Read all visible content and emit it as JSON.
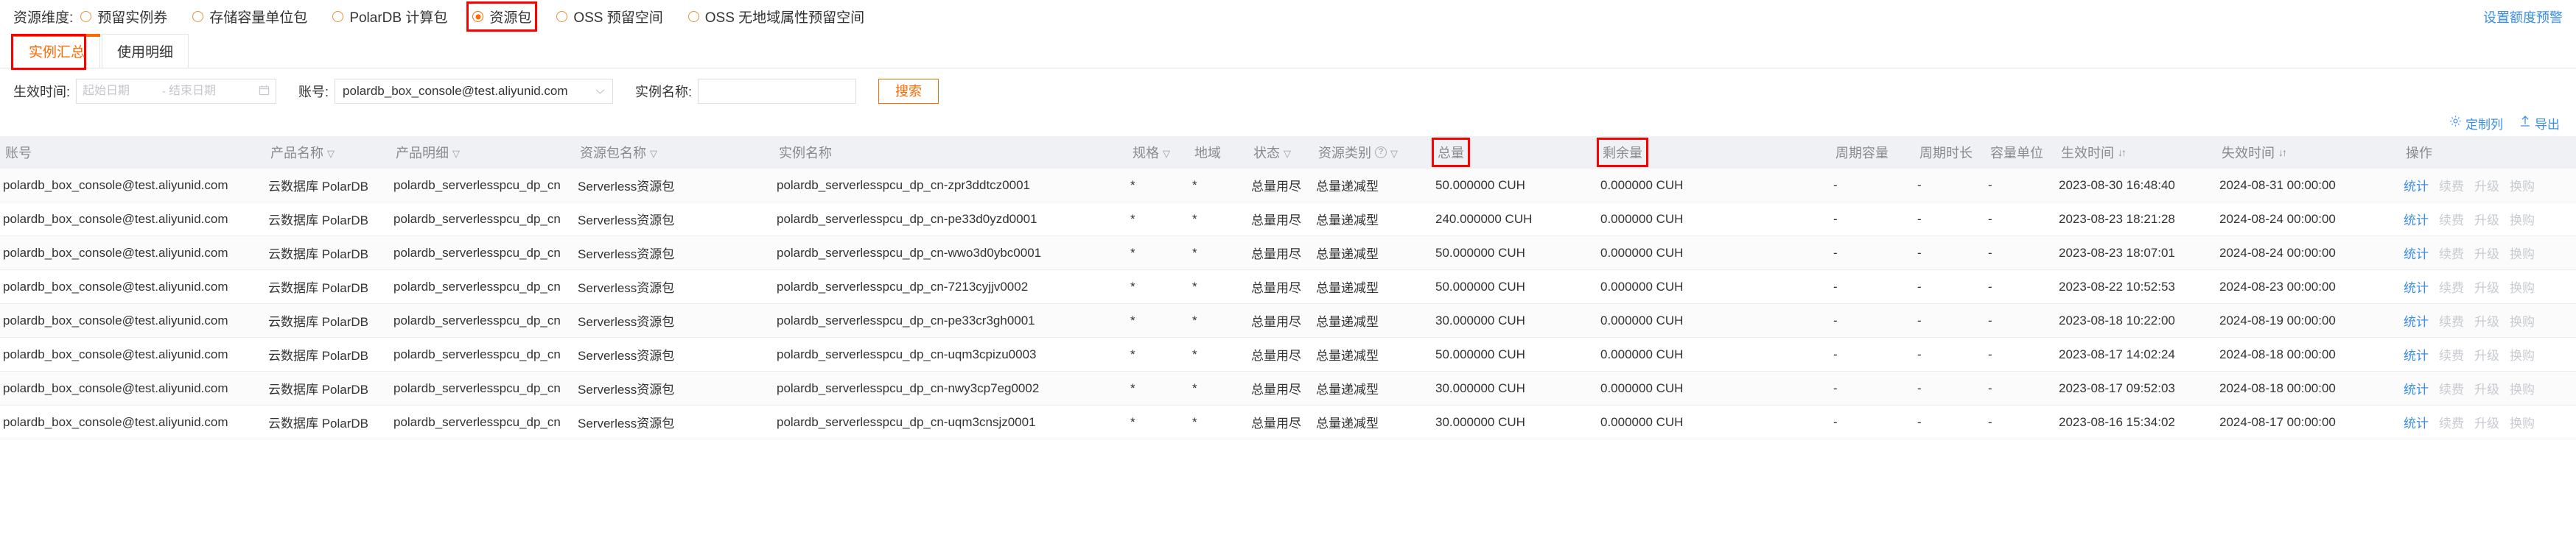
{
  "dimension_bar": {
    "label": "资源维度:",
    "options": [
      {
        "label": "预留实例券",
        "checked": false,
        "highlight": false
      },
      {
        "label": "存储容量单位包",
        "checked": false,
        "highlight": false
      },
      {
        "label": "PolarDB 计算包",
        "checked": false,
        "highlight": false
      },
      {
        "label": "资源包",
        "checked": true,
        "highlight": true
      },
      {
        "label": "OSS 预留空间",
        "checked": false,
        "highlight": false
      },
      {
        "label": "OSS 无地域属性预留空间",
        "checked": false,
        "highlight": false
      }
    ],
    "quota_alert_link": "设置额度预警"
  },
  "tabs": [
    {
      "label": "实例汇总",
      "active": true,
      "highlight": true
    },
    {
      "label": "使用明细",
      "active": false,
      "highlight": false
    }
  ],
  "filters": {
    "effective_time_label": "生效时间:",
    "date_start_placeholder": "起始日期",
    "date_separator": "-",
    "date_end_placeholder": "结束日期",
    "date_start_value": "",
    "date_end_value": "",
    "calendar_icon": "calendar-icon",
    "account_label": "账号:",
    "account_value": "polardb_box_console@test.aliyunid.com",
    "instance_name_label": "实例名称:",
    "instance_name_value": "",
    "instance_name_placeholder": "",
    "search_button": "搜索"
  },
  "toolbar": {
    "customize_columns": "定制列",
    "export": "导出",
    "gear_icon": "gear-icon",
    "export_icon": "upload-icon"
  },
  "table": {
    "columns": [
      {
        "key": "account",
        "label": "账号",
        "filter": false,
        "sort": false,
        "help": false,
        "highlight": false
      },
      {
        "key": "product",
        "label": "产品名称",
        "filter": true,
        "sort": false,
        "help": false,
        "highlight": false
      },
      {
        "key": "product_code",
        "label": "产品明细",
        "filter": true,
        "sort": false,
        "help": false,
        "highlight": false
      },
      {
        "key": "pkg_name",
        "label": "资源包名称",
        "filter": true,
        "sort": false,
        "help": false,
        "highlight": false
      },
      {
        "key": "instance",
        "label": "实例名称",
        "filter": false,
        "sort": false,
        "help": false,
        "highlight": false
      },
      {
        "key": "spec",
        "label": "规格",
        "filter": true,
        "sort": false,
        "help": false,
        "highlight": false
      },
      {
        "key": "region",
        "label": "地域",
        "filter": false,
        "sort": false,
        "help": false,
        "highlight": false
      },
      {
        "key": "status",
        "label": "状态",
        "filter": true,
        "sort": false,
        "help": false,
        "highlight": false
      },
      {
        "key": "res_type",
        "label": "资源类别",
        "filter": true,
        "sort": false,
        "help": true,
        "highlight": false
      },
      {
        "key": "total",
        "label": "总量",
        "filter": false,
        "sort": false,
        "help": false,
        "highlight": true
      },
      {
        "key": "remain",
        "label": "剩余量",
        "filter": false,
        "sort": false,
        "help": false,
        "highlight": true
      },
      {
        "key": "cyc_cap",
        "label": "周期容量",
        "filter": false,
        "sort": false,
        "help": false,
        "highlight": false
      },
      {
        "key": "cyc_len",
        "label": "周期时长",
        "filter": false,
        "sort": false,
        "help": false,
        "highlight": false
      },
      {
        "key": "cap_unit",
        "label": "容量单位",
        "filter": false,
        "sort": false,
        "help": false,
        "highlight": false
      },
      {
        "key": "eff_time",
        "label": "生效时间",
        "filter": false,
        "sort": true,
        "help": false,
        "highlight": false
      },
      {
        "key": "exp_time",
        "label": "失效时间",
        "filter": false,
        "sort": true,
        "help": false,
        "highlight": false
      },
      {
        "key": "actions",
        "label": "操作",
        "filter": false,
        "sort": false,
        "help": false,
        "highlight": false
      }
    ],
    "actions": [
      {
        "label": "统计",
        "enabled": true
      },
      {
        "label": "续费",
        "enabled": false
      },
      {
        "label": "升级",
        "enabled": false
      },
      {
        "label": "换购",
        "enabled": false
      }
    ],
    "rows": [
      {
        "account": "polardb_box_console@test.aliyunid.com",
        "product": "云数据库 PolarDB",
        "product_code": "polardb_serverlesspcu_dp_cn",
        "pkg_name": "Serverless资源包",
        "instance": "polardb_serverlesspcu_dp_cn-zpr3ddtcz0001",
        "spec": "*",
        "region": "*",
        "status": "总量用尽",
        "res_type": "总量递减型",
        "total": "50.000000 CUH",
        "remain": "0.000000 CUH",
        "cyc_cap": "-",
        "cyc_len": "-",
        "cap_unit": "-",
        "eff_time": "2023-08-30 16:48:40",
        "exp_time": "2024-08-31 00:00:00"
      },
      {
        "account": "polardb_box_console@test.aliyunid.com",
        "product": "云数据库 PolarDB",
        "product_code": "polardb_serverlesspcu_dp_cn",
        "pkg_name": "Serverless资源包",
        "instance": "polardb_serverlesspcu_dp_cn-pe33d0yzd0001",
        "spec": "*",
        "region": "*",
        "status": "总量用尽",
        "res_type": "总量递减型",
        "total": "240.000000 CUH",
        "remain": "0.000000 CUH",
        "cyc_cap": "-",
        "cyc_len": "-",
        "cap_unit": "-",
        "eff_time": "2023-08-23 18:21:28",
        "exp_time": "2024-08-24 00:00:00"
      },
      {
        "account": "polardb_box_console@test.aliyunid.com",
        "product": "云数据库 PolarDB",
        "product_code": "polardb_serverlesspcu_dp_cn",
        "pkg_name": "Serverless资源包",
        "instance": "polardb_serverlesspcu_dp_cn-wwo3d0ybc0001",
        "spec": "*",
        "region": "*",
        "status": "总量用尽",
        "res_type": "总量递减型",
        "total": "50.000000 CUH",
        "remain": "0.000000 CUH",
        "cyc_cap": "-",
        "cyc_len": "-",
        "cap_unit": "-",
        "eff_time": "2023-08-23 18:07:01",
        "exp_time": "2024-08-24 00:00:00"
      },
      {
        "account": "polardb_box_console@test.aliyunid.com",
        "product": "云数据库 PolarDB",
        "product_code": "polardb_serverlesspcu_dp_cn",
        "pkg_name": "Serverless资源包",
        "instance": "polardb_serverlesspcu_dp_cn-7213cyjjv0002",
        "spec": "*",
        "region": "*",
        "status": "总量用尽",
        "res_type": "总量递减型",
        "total": "50.000000 CUH",
        "remain": "0.000000 CUH",
        "cyc_cap": "-",
        "cyc_len": "-",
        "cap_unit": "-",
        "eff_time": "2023-08-22 10:52:53",
        "exp_time": "2024-08-23 00:00:00"
      },
      {
        "account": "polardb_box_console@test.aliyunid.com",
        "product": "云数据库 PolarDB",
        "product_code": "polardb_serverlesspcu_dp_cn",
        "pkg_name": "Serverless资源包",
        "instance": "polardb_serverlesspcu_dp_cn-pe33cr3gh0001",
        "spec": "*",
        "region": "*",
        "status": "总量用尽",
        "res_type": "总量递减型",
        "total": "30.000000 CUH",
        "remain": "0.000000 CUH",
        "cyc_cap": "-",
        "cyc_len": "-",
        "cap_unit": "-",
        "eff_time": "2023-08-18 10:22:00",
        "exp_time": "2024-08-19 00:00:00"
      },
      {
        "account": "polardb_box_console@test.aliyunid.com",
        "product": "云数据库 PolarDB",
        "product_code": "polardb_serverlesspcu_dp_cn",
        "pkg_name": "Serverless资源包",
        "instance": "polardb_serverlesspcu_dp_cn-uqm3cpizu0003",
        "spec": "*",
        "region": "*",
        "status": "总量用尽",
        "res_type": "总量递减型",
        "total": "50.000000 CUH",
        "remain": "0.000000 CUH",
        "cyc_cap": "-",
        "cyc_len": "-",
        "cap_unit": "-",
        "eff_time": "2023-08-17 14:02:24",
        "exp_time": "2024-08-18 00:00:00"
      },
      {
        "account": "polardb_box_console@test.aliyunid.com",
        "product": "云数据库 PolarDB",
        "product_code": "polardb_serverlesspcu_dp_cn",
        "pkg_name": "Serverless资源包",
        "instance": "polardb_serverlesspcu_dp_cn-nwy3cp7eg0002",
        "spec": "*",
        "region": "*",
        "status": "总量用尽",
        "res_type": "总量递减型",
        "total": "30.000000 CUH",
        "remain": "0.000000 CUH",
        "cyc_cap": "-",
        "cyc_len": "-",
        "cap_unit": "-",
        "eff_time": "2023-08-17 09:52:03",
        "exp_time": "2024-08-18 00:00:00"
      },
      {
        "account": "polardb_box_console@test.aliyunid.com",
        "product": "云数据库 PolarDB",
        "product_code": "polardb_serverlesspcu_dp_cn",
        "pkg_name": "Serverless资源包",
        "instance": "polardb_serverlesspcu_dp_cn-uqm3cnsjz0001",
        "spec": "*",
        "region": "*",
        "status": "总量用尽",
        "res_type": "总量递减型",
        "total": "30.000000 CUH",
        "remain": "0.000000 CUH",
        "cyc_cap": "-",
        "cyc_len": "-",
        "cap_unit": "-",
        "eff_time": "2023-08-16 15:34:02",
        "exp_time": "2024-08-17 00:00:00"
      }
    ]
  },
  "colors": {
    "accent_orange": "#ff6a00",
    "link_blue": "#3a8ee6",
    "highlight_red": "#ff0000",
    "header_bg": "#eff1f4"
  }
}
